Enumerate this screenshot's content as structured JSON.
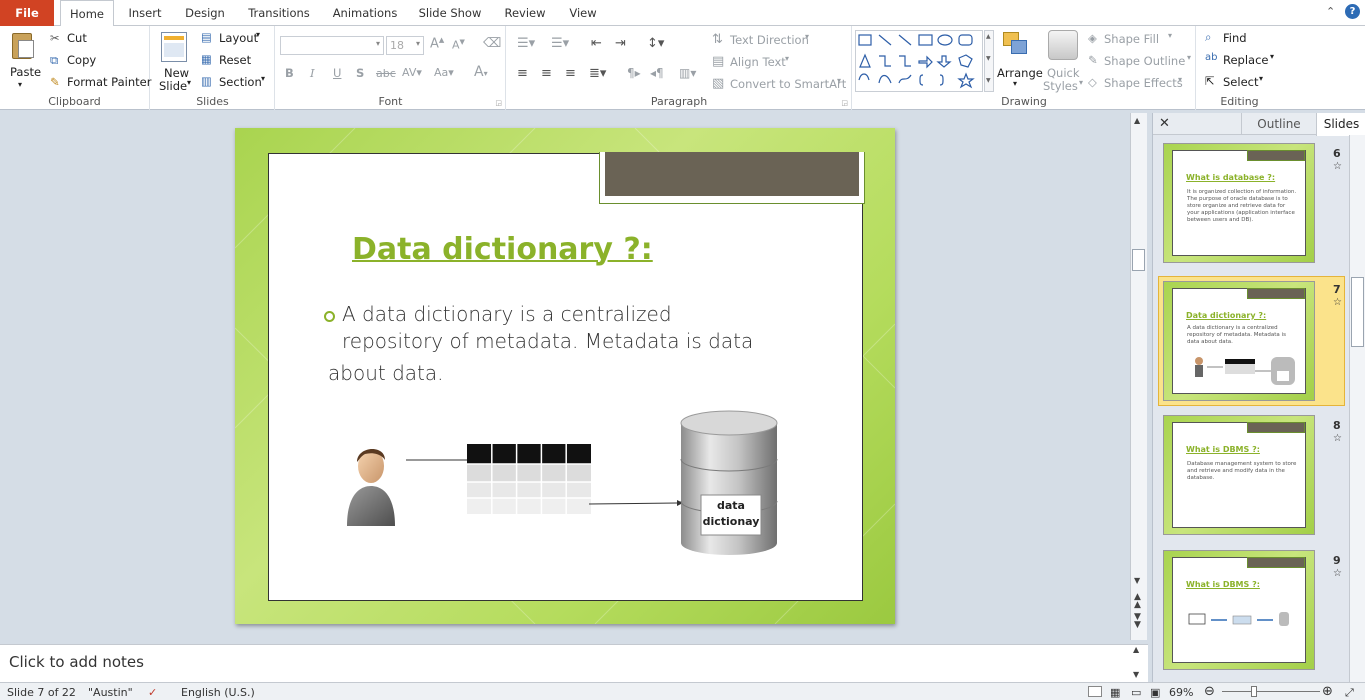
{
  "tabs": [
    "File",
    "Home",
    "Insert",
    "Design",
    "Transitions",
    "Animations",
    "Slide Show",
    "Review",
    "View"
  ],
  "clipboard": {
    "paste": "Paste",
    "cut": "Cut",
    "copy": "Copy",
    "format_painter": "Format Painter",
    "label": "Clipboard"
  },
  "slides_group": {
    "new_slide_1": "New",
    "new_slide_2": "Slide",
    "layout": "Layout",
    "reset": "Reset",
    "section": "Section",
    "label": "Slides"
  },
  "font_group": {
    "size": "18",
    "label": "Font"
  },
  "paragraph_group": {
    "text_direction": "Text Direction",
    "align_text": "Align Text",
    "convert": "Convert to SmartArt",
    "label": "Paragraph"
  },
  "drawing_group": {
    "arrange": "Arrange",
    "quick_styles_1": "Quick",
    "quick_styles_2": "Styles",
    "shape_fill": "Shape Fill",
    "shape_outline": "Shape Outline",
    "shape_effects": "Shape Effects",
    "label": "Drawing"
  },
  "editing_group": {
    "find": "Find",
    "replace": "Replace",
    "select": "Select",
    "label": "Editing"
  },
  "slide": {
    "title": "Data dictionary ?:",
    "line1": "A data dictionary is a centralized",
    "line2": "repository of metadata. Metadata is data",
    "line3": "about data.",
    "db_label_1": "data",
    "db_label_2": "dictionay"
  },
  "notes_placeholder": "Click to add notes",
  "pane": {
    "outline": "Outline",
    "slides": "Slides"
  },
  "thumbnails": [
    {
      "num": "6",
      "title": "What is database ?:",
      "text": "It is organized collection of information. The purpose of oracle database is to store organize and retrieve data for your applications (application interface between users and DB)."
    },
    {
      "num": "7",
      "title": "Data dictionary ?:",
      "text": "A data dictionary is a centralized repository of metadata. Metadata is data about data."
    },
    {
      "num": "8",
      "title": "What is DBMS ?:",
      "text": "Database management system to store and retrieve and modify data in the database."
    },
    {
      "num": "9",
      "title": "What is DBMS ?:",
      "text": ""
    }
  ],
  "status": {
    "slide": "Slide 7 of 22",
    "theme": "\"Austin\"",
    "language": "English (U.S.)",
    "zoom": "69%"
  },
  "colors": {
    "file_tab": "#d14323",
    "title_green": "#8bb22a",
    "frame_brown": "#6a6355"
  }
}
